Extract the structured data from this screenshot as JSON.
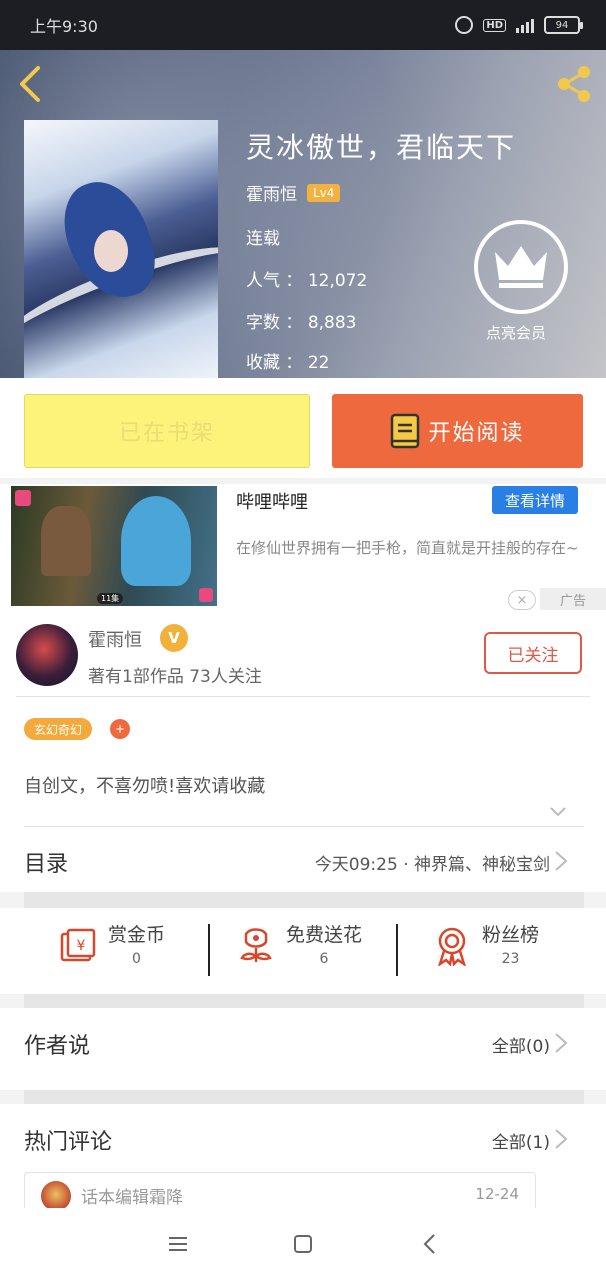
{
  "status_bar": {
    "time": "上午9:30",
    "battery": "94",
    "hd_label": "HD"
  },
  "book": {
    "title": "灵冰傲世，君临天下",
    "author": "霍雨恒",
    "level": "Lv4",
    "status": "连载",
    "popularity_label": "人气",
    "popularity": "12,072",
    "words_label": "字数",
    "words": "8,883",
    "favorites_label": "收藏",
    "favorites": "22",
    "vip_label": "点亮会员"
  },
  "actions": {
    "shelf_label": "已在书架",
    "read_label": "开始阅读"
  },
  "ad": {
    "name": "哔哩哔哩",
    "detail_label": "查看详情",
    "description": "在修仙世界拥有一把手枪，简直就是开挂般的存在~",
    "ad_mark": "广告",
    "close_icon": "×",
    "episode_tag": "11集"
  },
  "author_card": {
    "name": "霍雨恒",
    "verified": "V",
    "stats": "著有1部作品 73人关注",
    "follow_label": "已关注"
  },
  "tags": {
    "genre": "玄幻奇幻",
    "add": "+"
  },
  "intro": "自创文，不喜勿喷!喜欢请收藏",
  "catalog": {
    "label": "目录",
    "latest": "今天09:25 · 神界篇、神秘宝剑"
  },
  "rewards": [
    {
      "label": "赏金币",
      "count": "0"
    },
    {
      "label": "免费送花",
      "count": "6"
    },
    {
      "label": "粉丝榜",
      "count": "23"
    }
  ],
  "author_says": {
    "title": "作者说",
    "more": "全部(0)"
  },
  "hot_comments": {
    "title": "热门评论",
    "more": "全部(1)",
    "first": {
      "user": "话本编辑霜降",
      "date": "12-24"
    }
  },
  "colors": {
    "primary": "#ee6a3e",
    "accent_yellow": "#fdf37a",
    "badge": "#f3b240",
    "link_blue": "#2a7fe5"
  }
}
